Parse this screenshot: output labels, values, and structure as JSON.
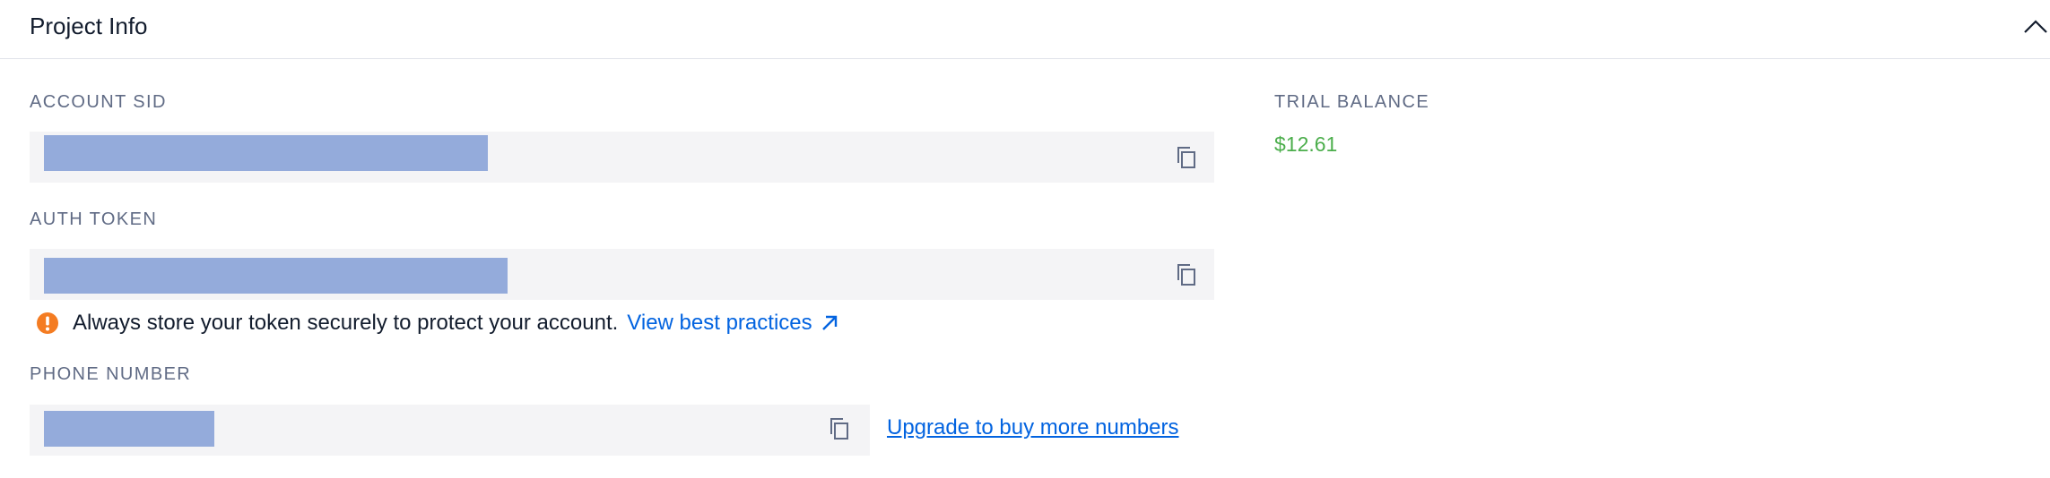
{
  "header": {
    "title": "Project Info",
    "collapse_icon": "chevron-up-icon"
  },
  "account_sid": {
    "label": "ACCOUNT SID",
    "value": "",
    "copy_icon": "copy-icon"
  },
  "auth_token": {
    "label": "AUTH TOKEN",
    "value": "",
    "copy_icon": "copy-icon"
  },
  "warning": {
    "icon": "warning-icon",
    "text": "Always store your token securely to protect your account.",
    "link_text": "View best practices",
    "link_icon": "external-link-icon"
  },
  "phone_number": {
    "label": "PHONE NUMBER",
    "value": "",
    "copy_icon": "copy-icon",
    "upgrade_link": "Upgrade to buy more numbers"
  },
  "trial_balance": {
    "label": "TRIAL BALANCE",
    "amount": "$12.61"
  },
  "colors": {
    "balance": "#4cae4c",
    "link": "#0263e0",
    "warning": "#f47c22",
    "redaction": "#94abdb",
    "field_bg": "#f4f4f6"
  }
}
